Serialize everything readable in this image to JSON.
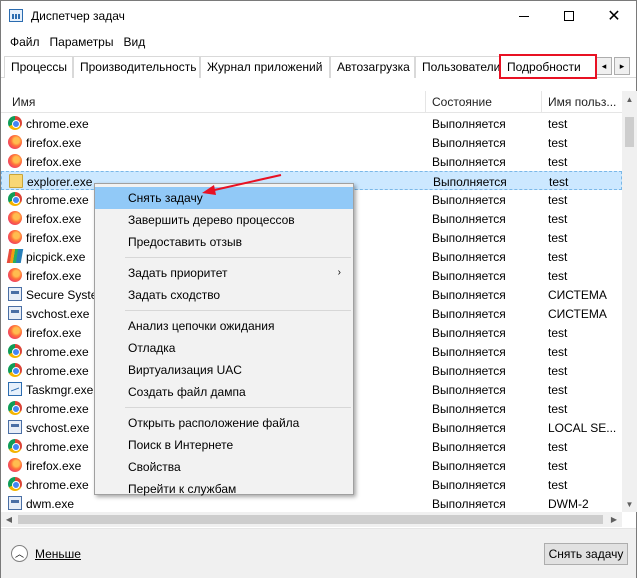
{
  "window": {
    "title": "Диспетчер задач",
    "icon": "task-manager-icon",
    "controls": {
      "minimize": "minimize-icon",
      "maximize": "maximize-icon",
      "close": "✕"
    }
  },
  "menu": [
    "Файл",
    "Параметры",
    "Вид"
  ],
  "tabs": [
    {
      "label": "Процессы"
    },
    {
      "label": "Производительность"
    },
    {
      "label": "Журнал приложений"
    },
    {
      "label": "Автозагрузка"
    },
    {
      "label": "Пользователи"
    },
    {
      "label": "Подробности",
      "active": true
    }
  ],
  "tab_arrows": {
    "left": "◂",
    "right": "▸"
  },
  "columns": {
    "name": "Имя",
    "state": "Состояние",
    "user": "Имя польз..."
  },
  "rows": [
    {
      "icon": "chrome",
      "name": "chrome.exe",
      "state": "Выполняется",
      "user": "test"
    },
    {
      "icon": "firefox",
      "name": "firefox.exe",
      "state": "Выполняется",
      "user": "test"
    },
    {
      "icon": "firefox",
      "name": "firefox.exe",
      "state": "Выполняется",
      "user": "test"
    },
    {
      "icon": "explorer",
      "name": "explorer.exe",
      "state": "Выполняется",
      "user": "test",
      "selected": true
    },
    {
      "icon": "chrome",
      "name": "chrome.exe",
      "state": "Выполняется",
      "user": "test"
    },
    {
      "icon": "firefox",
      "name": "firefox.exe",
      "state": "Выполняется",
      "user": "test"
    },
    {
      "icon": "firefox",
      "name": "firefox.exe",
      "state": "Выполняется",
      "user": "test"
    },
    {
      "icon": "picpick",
      "name": "picpick.exe",
      "state": "Выполняется",
      "user": "test"
    },
    {
      "icon": "firefox",
      "name": "firefox.exe",
      "state": "Выполняется",
      "user": "test"
    },
    {
      "icon": "generic",
      "name": "Secure System",
      "state": "Выполняется",
      "user": "СИСТЕМА"
    },
    {
      "icon": "generic",
      "name": "svchost.exe",
      "state": "Выполняется",
      "user": "СИСТЕМА"
    },
    {
      "icon": "firefox",
      "name": "firefox.exe",
      "state": "Выполняется",
      "user": "test"
    },
    {
      "icon": "chrome",
      "name": "chrome.exe",
      "state": "Выполняется",
      "user": "test"
    },
    {
      "icon": "chrome",
      "name": "chrome.exe",
      "state": "Выполняется",
      "user": "test"
    },
    {
      "icon": "taskmgr",
      "name": "Taskmgr.exe",
      "state": "Выполняется",
      "user": "test"
    },
    {
      "icon": "chrome",
      "name": "chrome.exe",
      "state": "Выполняется",
      "user": "test"
    },
    {
      "icon": "generic",
      "name": "svchost.exe",
      "state": "Выполняется",
      "user": "LOCAL SE..."
    },
    {
      "icon": "chrome",
      "name": "chrome.exe",
      "state": "Выполняется",
      "user": "test"
    },
    {
      "icon": "firefox",
      "name": "firefox.exe",
      "state": "Выполняется",
      "user": "test"
    },
    {
      "icon": "chrome",
      "name": "chrome.exe",
      "state": "Выполняется",
      "user": "test"
    },
    {
      "icon": "generic",
      "name": "dwm.exe",
      "state": "Выполняется",
      "user": "DWM-2"
    }
  ],
  "context_menu": [
    {
      "label": "Снять задачу",
      "highlighted": true
    },
    {
      "label": "Завершить дерево процессов"
    },
    {
      "label": "Предоставить отзыв"
    },
    {
      "separator": true
    },
    {
      "label": "Задать приоритет",
      "submenu": "›"
    },
    {
      "label": "Задать сходство"
    },
    {
      "separator": true
    },
    {
      "label": "Анализ цепочки ожидания"
    },
    {
      "label": "Отладка"
    },
    {
      "label": "Виртуализация UAC"
    },
    {
      "label": "Создать файл дампа"
    },
    {
      "separator": true
    },
    {
      "label": "Открыть расположение файла"
    },
    {
      "label": "Поиск в Интернете"
    },
    {
      "label": "Свойства"
    },
    {
      "label": "Перейти к службам"
    }
  ],
  "footer": {
    "less_label": "Меньше",
    "less_icon": "chevron-up-circle-icon",
    "end_task_label": "Снять задачу"
  },
  "colors": {
    "selected_row": "#cce8ff",
    "menu_highlight": "#91c9f7",
    "annotation": "#e81123"
  }
}
